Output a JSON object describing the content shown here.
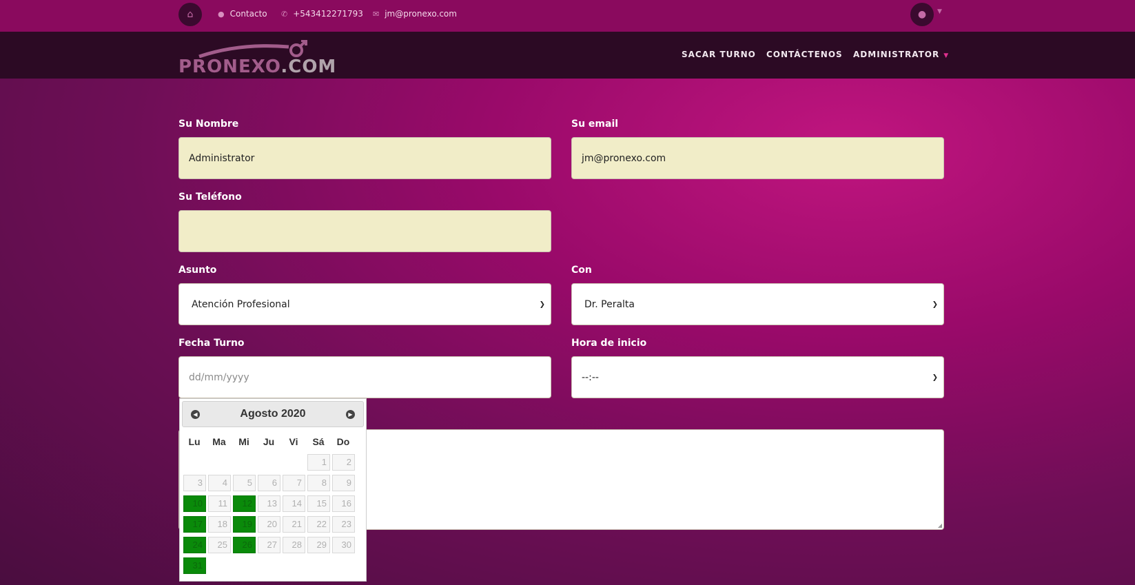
{
  "topbar": {
    "contact_label": "Contacto",
    "phone": "+543412271793",
    "email": "jm@pronexo.com",
    "icons": [
      "home-icon",
      "map-marker-icon",
      "phone-icon",
      "envelope-icon",
      "globe-icon"
    ]
  },
  "navbar": {
    "logo_main": "PRONEXO",
    "logo_suffix": ".COM",
    "items": [
      "SACAR TURNO",
      "CONTÁCTENOS",
      "ADMINISTRATOR"
    ]
  },
  "form": {
    "name": {
      "label": "Su Nombre",
      "value": "Administrator"
    },
    "email": {
      "label": "Su email",
      "value": "jm@pronexo.com"
    },
    "phone": {
      "label": "Su Teléfono",
      "value": ""
    },
    "subject": {
      "label": "Asunto",
      "value": "Atención Profesional"
    },
    "with": {
      "label": "Con",
      "value": "Dr. Peralta"
    },
    "date": {
      "label": "Fecha Turno",
      "placeholder": "dd/mm/yyyy"
    },
    "time": {
      "label": "Hora de inicio",
      "value": "--:--"
    }
  },
  "datepicker": {
    "title": "Agosto 2020",
    "weekdays": [
      "Lu",
      "Ma",
      "Mi",
      "Ju",
      "Vi",
      "Sá",
      "Do"
    ],
    "first_weekday_index": 5,
    "days_in_month": 31,
    "available_days": [
      10,
      12,
      17,
      19,
      24,
      26,
      31
    ]
  },
  "colors": {
    "topbar_bg": "#8a0a5e",
    "navbar_bg": "#2c0a24",
    "field_filled_bg": "#f1edc8",
    "available_day_bg": "#0a8a0a"
  }
}
